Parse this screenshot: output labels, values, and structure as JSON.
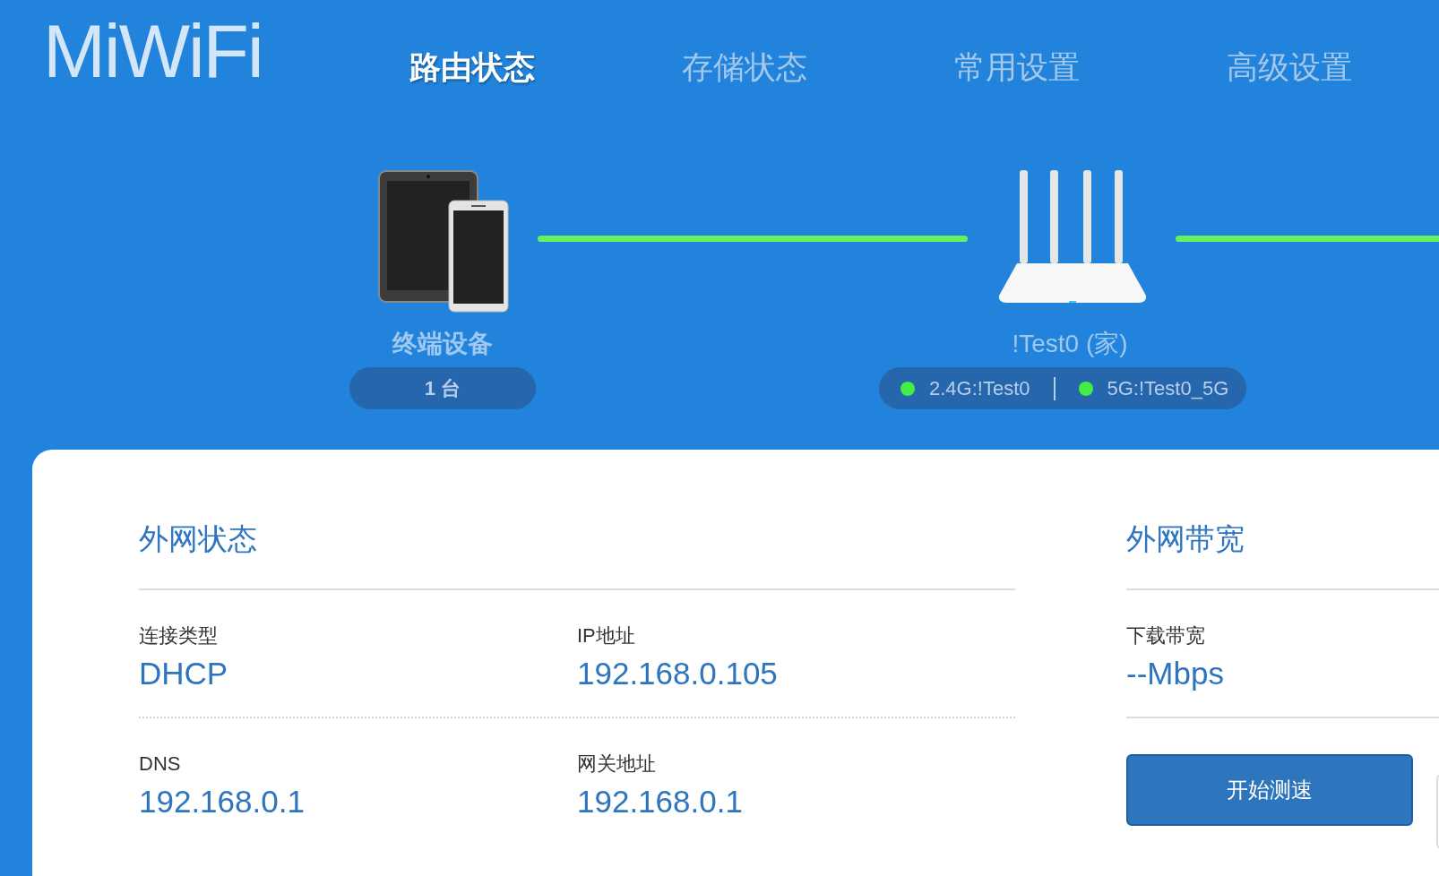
{
  "logo": "MiWiFi",
  "nav": [
    {
      "label": "路由状态",
      "selected": true
    },
    {
      "label": "存储状态",
      "selected": false
    },
    {
      "label": "常用设置",
      "selected": false
    },
    {
      "label": "高级设置",
      "selected": false
    }
  ],
  "topology": {
    "clients": {
      "label": "终端设备",
      "count": "1 台"
    },
    "router": {
      "name": "!Test0 (家)",
      "bands": [
        {
          "label": "2.4G:!Test0",
          "on": true
        },
        {
          "label": "5G:!Test0_5G",
          "on": true
        }
      ]
    }
  },
  "wan_status": {
    "title": "外网状态",
    "fields": [
      {
        "label": "连接类型",
        "value": "DHCP"
      },
      {
        "label": "IP地址",
        "value": "192.168.0.105"
      },
      {
        "label": "DNS",
        "value": "192.168.0.1"
      },
      {
        "label": "网关地址",
        "value": "192.168.0.1"
      }
    ]
  },
  "bandwidth": {
    "title": "外网带宽",
    "fields": [
      {
        "label": "下载带宽",
        "value": "--Mbps"
      }
    ],
    "button": "开始测速"
  }
}
